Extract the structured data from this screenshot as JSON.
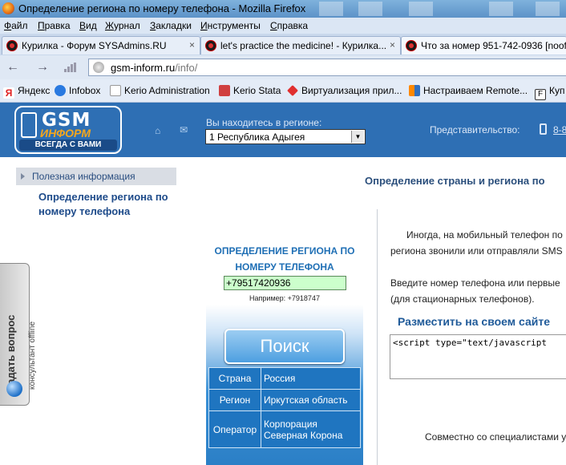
{
  "window": {
    "title": "Определение региона по номеру телефона - Mozilla Firefox"
  },
  "menu": [
    {
      "label": "Файл",
      "key": "Ф",
      "rest": "айл"
    },
    {
      "label": "Правка",
      "key": "П",
      "rest": "равка"
    },
    {
      "label": "Вид",
      "key": "В",
      "rest": "ид"
    },
    {
      "label": "Журнал",
      "key": "Ж",
      "rest": "урнал"
    },
    {
      "label": "Закладки",
      "key": "З",
      "rest": "акладки"
    },
    {
      "label": "Инструменты",
      "key": "И",
      "rest": "нструменты"
    },
    {
      "label": "Справка",
      "key": "С",
      "rest": "правка"
    }
  ],
  "tabs": [
    {
      "label": "Курилка - Форум SYSAdmins.RU",
      "close": "×"
    },
    {
      "label": "let's practice the medicine! - Курилка...",
      "close": "×"
    },
    {
      "label": "Что за номер 951-742-0936 [nooff",
      "close": ""
    }
  ],
  "nav": {
    "back": "←",
    "forward": "→",
    "url_host": "gsm-inform.ru",
    "url_path": "/info/"
  },
  "bookmarks": [
    {
      "label": "Яндекс",
      "color": "#e02020"
    },
    {
      "label": "Infobox",
      "color": "#2a7ae0"
    },
    {
      "label": "Kerio Administration",
      "color": "#d0d0d0"
    },
    {
      "label": "Kerio Stata",
      "color": "#d04040"
    },
    {
      "label": "Виртуализация прил...",
      "color": "#e03030"
    },
    {
      "label": "Настраиваем Remote...",
      "color": "#3070c0"
    },
    {
      "label": "Куп",
      "color": "#ffffff"
    }
  ],
  "header": {
    "logo_main": "GSM",
    "logo_sub": "ИНФОРМ",
    "logo_slogan": "ВСЕГДА С ВАМИ",
    "home_icon": "⌂",
    "mail_icon": "✉",
    "region_label": "Вы находитесь в регионе:",
    "region_value": "1 Республика Адыгея",
    "region_arrow": "▼",
    "representation_label": "Представительство:",
    "phone": "8-8"
  },
  "sidebar": {
    "section": "Полезная информация",
    "link_line1": "Определение региона по",
    "link_line2": "номеру телефона"
  },
  "widget": {
    "title_line1": "ОПРЕДЕЛЕНИЕ РЕГИОНА ПО",
    "title_line2": "НОМЕРУ ТЕЛЕФОНА",
    "input_value": "+79517420936",
    "example": "Например: +7918747",
    "search_button": "Поиск",
    "rows": [
      {
        "key": "Страна",
        "value": "Россия"
      },
      {
        "key": "Регион",
        "value": "Иркутская область"
      },
      {
        "key": "Оператор",
        "value_line1": "Корпорация",
        "value_line2": "Северная Корона"
      }
    ]
  },
  "content": {
    "title": "Определение страны и региона по",
    "p1_line1": "Иногда, на мобильный телефон по",
    "p1_line2": "региона звонили или отправляли SMS",
    "p2_line1": "Введите номер телефона или первые",
    "p2_line2": "(для стационарных телефонов).",
    "embed_heading": "Разместить на своем сайте",
    "embed_code": "<script type=\"text/javascript",
    "footer": "Совместно со специалистами y"
  },
  "ask": {
    "title": "Задать вопрос",
    "subtitle": "консультант offline"
  }
}
